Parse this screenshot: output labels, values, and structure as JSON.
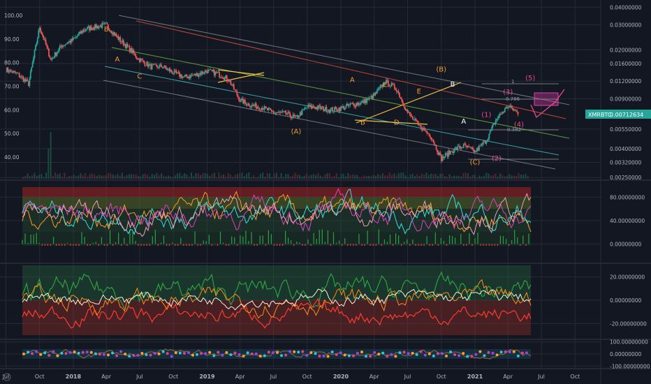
{
  "chart_data": {
    "type": "line",
    "symbol_badge": {
      "symbol": "XMRBTC",
      "value": "0.00712634"
    },
    "main_panel": {
      "left_axis_ticks": [
        "100.00",
        "90.00",
        "80.00",
        "70.00",
        "60.00",
        "50.00",
        "40.00"
      ],
      "left_axis_values": [
        100,
        90,
        80,
        70,
        60,
        50,
        40
      ],
      "right_axis_ticks": [
        "0.04000000",
        "0.03000000",
        "0.02000000",
        "0.01600000",
        "0.01200000",
        "0.00900000",
        "0.00550000",
        "0.00400000",
        "0.00320000",
        "0.00250000"
      ],
      "right_axis_values": [
        0.04,
        0.03,
        0.02,
        0.016,
        0.012,
        0.009,
        0.0055,
        0.004,
        0.0032,
        0.0025
      ],
      "right_scale": "log",
      "price_series": {
        "x": [
          "2017-07",
          "2017-08",
          "2017-09",
          "2017-10",
          "2017-11",
          "2017-12",
          "2018-01",
          "2018-02",
          "2018-03",
          "2018-04",
          "2018-05",
          "2018-06",
          "2018-07",
          "2018-08",
          "2018-09",
          "2018-10",
          "2018-11",
          "2018-12",
          "2019-01",
          "2019-02",
          "2019-03",
          "2019-04",
          "2019-05",
          "2019-06",
          "2019-07",
          "2019-08",
          "2019-09",
          "2019-10",
          "2019-11",
          "2019-12",
          "2020-01",
          "2020-02",
          "2020-03",
          "2020-04",
          "2020-05",
          "2020-06",
          "2020-07",
          "2020-08",
          "2020-09",
          "2020-10",
          "2020-11",
          "2020-12",
          "2021-01",
          "2021-02",
          "2021-03",
          "2021-04",
          "2021-05"
        ],
        "values": [
          0.0145,
          0.0135,
          0.0115,
          0.029,
          0.017,
          0.0215,
          0.0235,
          0.028,
          0.029,
          0.03,
          0.0245,
          0.0205,
          0.017,
          0.0152,
          0.0152,
          0.0138,
          0.0128,
          0.0133,
          0.0142,
          0.0135,
          0.0123,
          0.0088,
          0.0081,
          0.0078,
          0.0072,
          0.0071,
          0.0066,
          0.0079,
          0.0078,
          0.0075,
          0.0077,
          0.0082,
          0.0085,
          0.0095,
          0.0119,
          0.0106,
          0.0072,
          0.0058,
          0.005,
          0.0034,
          0.0039,
          0.0042,
          0.0038,
          0.0046,
          0.0065,
          0.008,
          0.0071
        ]
      },
      "wave_labels": [
        {
          "text": "B",
          "x": "2018-04",
          "y": 0.027,
          "color": "#f39c2c"
        },
        {
          "text": "A",
          "x": "2018-05",
          "y": 0.0165,
          "color": "#f39c2c"
        },
        {
          "text": "C",
          "x": "2018-07",
          "y": 0.0125,
          "color": "#f39c2c"
        },
        {
          "text": "(A)",
          "x": "2019-09",
          "y": 0.0051,
          "color": "#f39c2c"
        },
        {
          "text": "A",
          "x": "2020-02",
          "y": 0.0118,
          "color": "#f39c2c"
        },
        {
          "text": "B",
          "x": "2020-03",
          "y": 0.0059,
          "color": "#f39c2c"
        },
        {
          "text": "C",
          "x": "2020-05",
          "y": 0.0109,
          "color": "#f39c2c"
        },
        {
          "text": "D",
          "x": "2020-06",
          "y": 0.0059,
          "color": "#f39c2c"
        },
        {
          "text": "E",
          "x": "2020-08",
          "y": 0.0098,
          "color": "#f39c2c"
        },
        {
          "text": "(B)",
          "x": "2020-10",
          "y": 0.014,
          "color": "#f39c2c"
        },
        {
          "text": "B",
          "x": "2020-11",
          "y": 0.011,
          "color": "#ffffff"
        },
        {
          "text": "A",
          "x": "2020-12",
          "y": 0.006,
          "color": "#ffffff"
        },
        {
          "text": "(C)",
          "x": "2021-01",
          "y": 0.0031,
          "color": "#f39c2c"
        },
        {
          "text": "(1)",
          "x": "2021-02",
          "y": 0.0067,
          "color": "#e84a8a"
        },
        {
          "text": "(2)",
          "x": "2021-03",
          "y": 0.0033,
          "color": "#e84a8a"
        },
        {
          "text": "(3)",
          "x": "2021-04",
          "y": 0.0097,
          "color": "#e84a8a"
        },
        {
          "text": "(4)",
          "x": "2021-05",
          "y": 0.0057,
          "color": "#e84a8a"
        },
        {
          "text": "(5)",
          "x": "2021-06",
          "y": 0.0122,
          "color": "#e84a8a"
        }
      ],
      "fib_labels": [
        "1",
        "0.786",
        "0.382"
      ]
    },
    "panel_2": {
      "ticks": [
        "80.00000000",
        "40.00000000",
        "0.00000000"
      ],
      "values": [
        80,
        40,
        0
      ],
      "series": [
        {
          "color": "#ff9c2a"
        },
        {
          "color": "#38e0e0"
        },
        {
          "color": "#e040c0"
        },
        {
          "color": "#f0a0b0"
        }
      ]
    },
    "panel_3": {
      "ticks": [
        "20.00000000",
        "0.00000000",
        "-20.00000000"
      ],
      "values": [
        20,
        0,
        -20
      ],
      "series": [
        {
          "color": "#2ea043"
        },
        {
          "color": "#ff3b2f"
        },
        {
          "color": "#ff8c1a"
        },
        {
          "color": "#f5f0dc"
        }
      ]
    },
    "panel_4": {
      "ticks": [
        "100.00000000",
        "0.00000000",
        "-100.00000000"
      ],
      "values": [
        100,
        0,
        -100
      ]
    },
    "x_axis_ticks": [
      "Jul",
      "Oct",
      "2018",
      "Apr",
      "Jul",
      "Oct",
      "2019",
      "Apr",
      "Jul",
      "Oct",
      "2020",
      "Apr",
      "Jul",
      "Oct",
      "2021",
      "Apr",
      "Jul",
      "Oct"
    ],
    "x_axis_dates": [
      "2017-07",
      "2017-10",
      "2018-01",
      "2018-04",
      "2018-07",
      "2018-10",
      "2019-01",
      "2019-04",
      "2019-07",
      "2019-10",
      "2020-01",
      "2020-04",
      "2020-07",
      "2020-10",
      "2021-01",
      "2021-04",
      "2021-07",
      "2021-10"
    ],
    "colors": {
      "background": "#131722",
      "grid": "#242a38",
      "bull": "#26a69a",
      "bear": "#ef5350",
      "wave": "#f39c2c",
      "impulse": "#e84a8a",
      "badge": "#26a69a"
    }
  }
}
